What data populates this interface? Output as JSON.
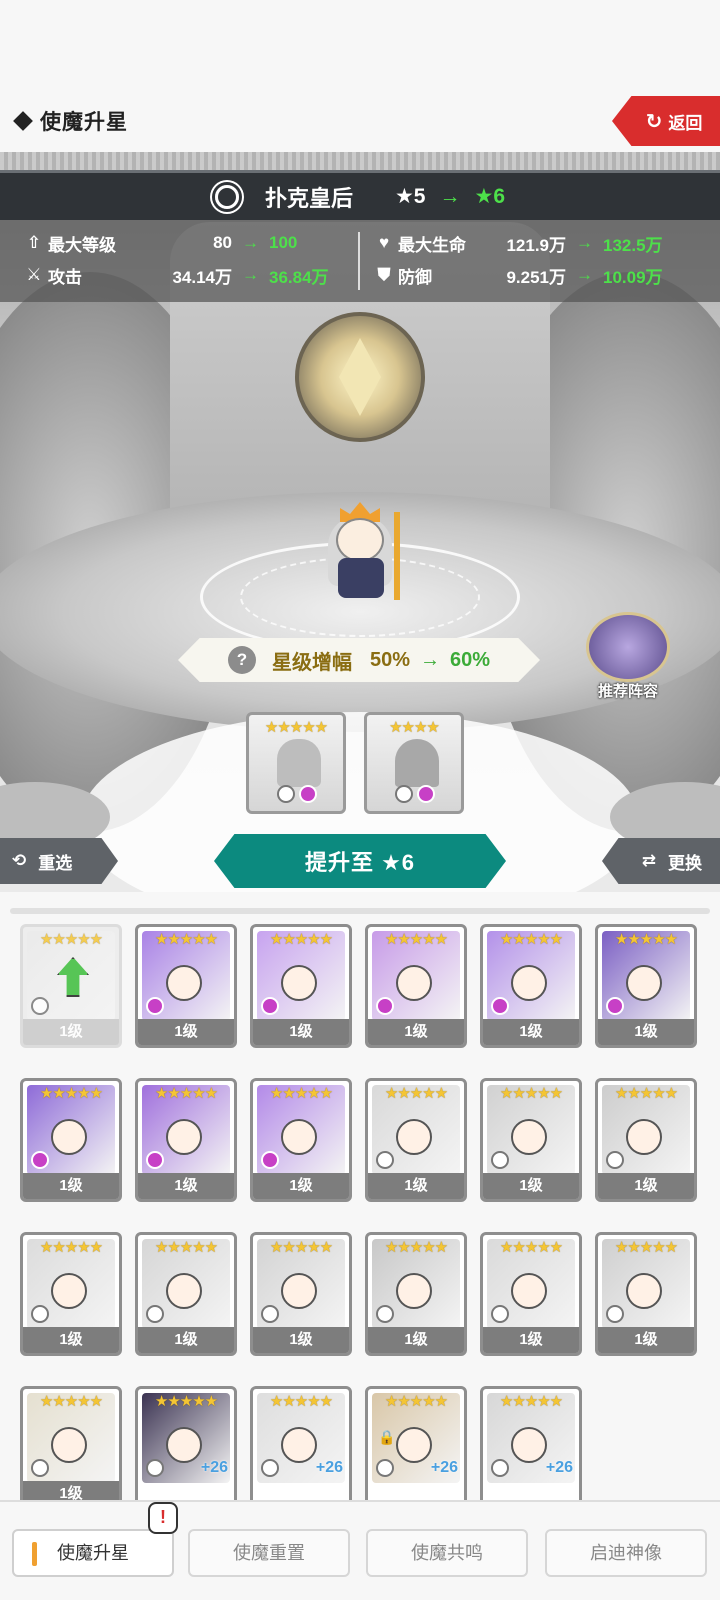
{
  "header": {
    "title": "使魔升星",
    "back_label": "返回"
  },
  "unit": {
    "name": "扑克皇后",
    "star_from": "★5",
    "star_to": "★6",
    "arrow": "→"
  },
  "stats": [
    {
      "icon": "level-up-icon",
      "label": "最大等级",
      "old": "80",
      "new": "100"
    },
    {
      "icon": "attack-icon",
      "label": "攻击",
      "old": "34.14万",
      "new": "36.84万"
    },
    {
      "icon": "heart-icon",
      "label": "最大生命",
      "old": "121.9万",
      "new": "132.5万"
    },
    {
      "icon": "shield-icon",
      "label": "防御",
      "old": "9.251万",
      "new": "10.09万"
    }
  ],
  "boost": {
    "help": "?",
    "label": "星级增幅",
    "from": "50%",
    "to": "60%"
  },
  "recommend_label": "推荐阵容",
  "material_slots": [
    {
      "stars": "★★★★★"
    },
    {
      "stars": "★★★★"
    }
  ],
  "actions": {
    "reselect": "重选",
    "upgrade": "提升至 ★6",
    "change": "更换"
  },
  "grid_cards": [
    {
      "stars": "★★★★★",
      "level": "1级"
    },
    {
      "stars": "★★★★★",
      "level": "1级"
    },
    {
      "stars": "★★★★★",
      "level": "1级"
    },
    {
      "stars": "★★★★★",
      "level": "1级"
    },
    {
      "stars": "★★★★★",
      "level": "1级"
    },
    {
      "stars": "★★★★★",
      "level": "1级"
    },
    {
      "stars": "★★★★★",
      "level": "1级"
    },
    {
      "stars": "★★★★★",
      "level": "1级"
    },
    {
      "stars": "★★★★★",
      "level": "1级"
    },
    {
      "stars": "★★★★★",
      "level": "1级"
    },
    {
      "stars": "★★★★★",
      "level": "1级"
    },
    {
      "stars": "★★★★★",
      "level": "1级"
    },
    {
      "stars": "★★★★★",
      "level": "1级"
    },
    {
      "stars": "★★★★★",
      "level": "1级"
    },
    {
      "stars": "★★★★★",
      "level": "1级"
    },
    {
      "stars": "★★★★★",
      "level": "1级"
    },
    {
      "stars": "★★★★★",
      "level": "1级"
    },
    {
      "stars": "★★★★★",
      "level": "1级"
    },
    {
      "stars": "★★★★★",
      "level": "1级",
      "plus": ""
    },
    {
      "stars": "★★★★★",
      "level": "",
      "plus": "+26"
    },
    {
      "stars": "★★★★★",
      "level": "",
      "plus": "+26"
    },
    {
      "stars": "★★★★★",
      "level": "",
      "plus": "+26"
    },
    {
      "stars": "★★★★★",
      "level": "",
      "plus": "+26"
    }
  ],
  "bottom_tabs": [
    "使魔升星",
    "使魔重置",
    "使魔共鸣",
    "启迪神像"
  ],
  "alert": "!",
  "colors": {
    "accent_green": "#4de04a",
    "teal": "#0c8a7f",
    "red": "#d92d2d",
    "gold": "#f4c534",
    "purple": "#8a55d6"
  }
}
